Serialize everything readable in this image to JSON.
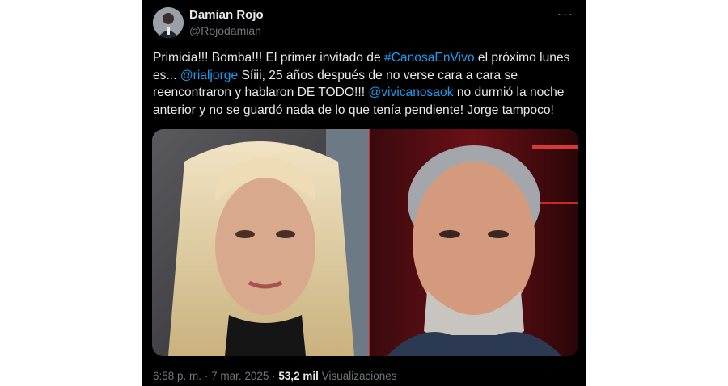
{
  "author": {
    "display_name": "Damian Rojo",
    "handle": "@Rojodamian"
  },
  "more_icon": "more-horizontal-icon",
  "tweet": {
    "segments": [
      {
        "text": "Primicia!!! Bomba!!! El primer invitado de ",
        "type": "text"
      },
      {
        "text": "#CanosaEnVivo",
        "type": "hashtag"
      },
      {
        "text": " el próximo lunes es... ",
        "type": "text"
      },
      {
        "text": "@rialjorge",
        "type": "mention"
      },
      {
        "text": " Síiii, 25 años después de no verse cara a cara se reencontraron y hablaron DE TODO!!! ",
        "type": "text"
      },
      {
        "text": "@vivicanosaok",
        "type": "mention"
      },
      {
        "text": " no durmió la noche anterior y no se guardó nada de lo que tenía pendiente! Jorge tampoco!",
        "type": "text"
      }
    ]
  },
  "footer": {
    "time": "6:58 p. m.",
    "separator": "·",
    "date": "7 mar. 2025",
    "views_count": "53,2 mil",
    "views_label": "Visualizaciones"
  },
  "colors": {
    "background": "#000000",
    "text": "#e7e9ea",
    "secondary": "#71767b",
    "link": "#1d9bf0"
  }
}
